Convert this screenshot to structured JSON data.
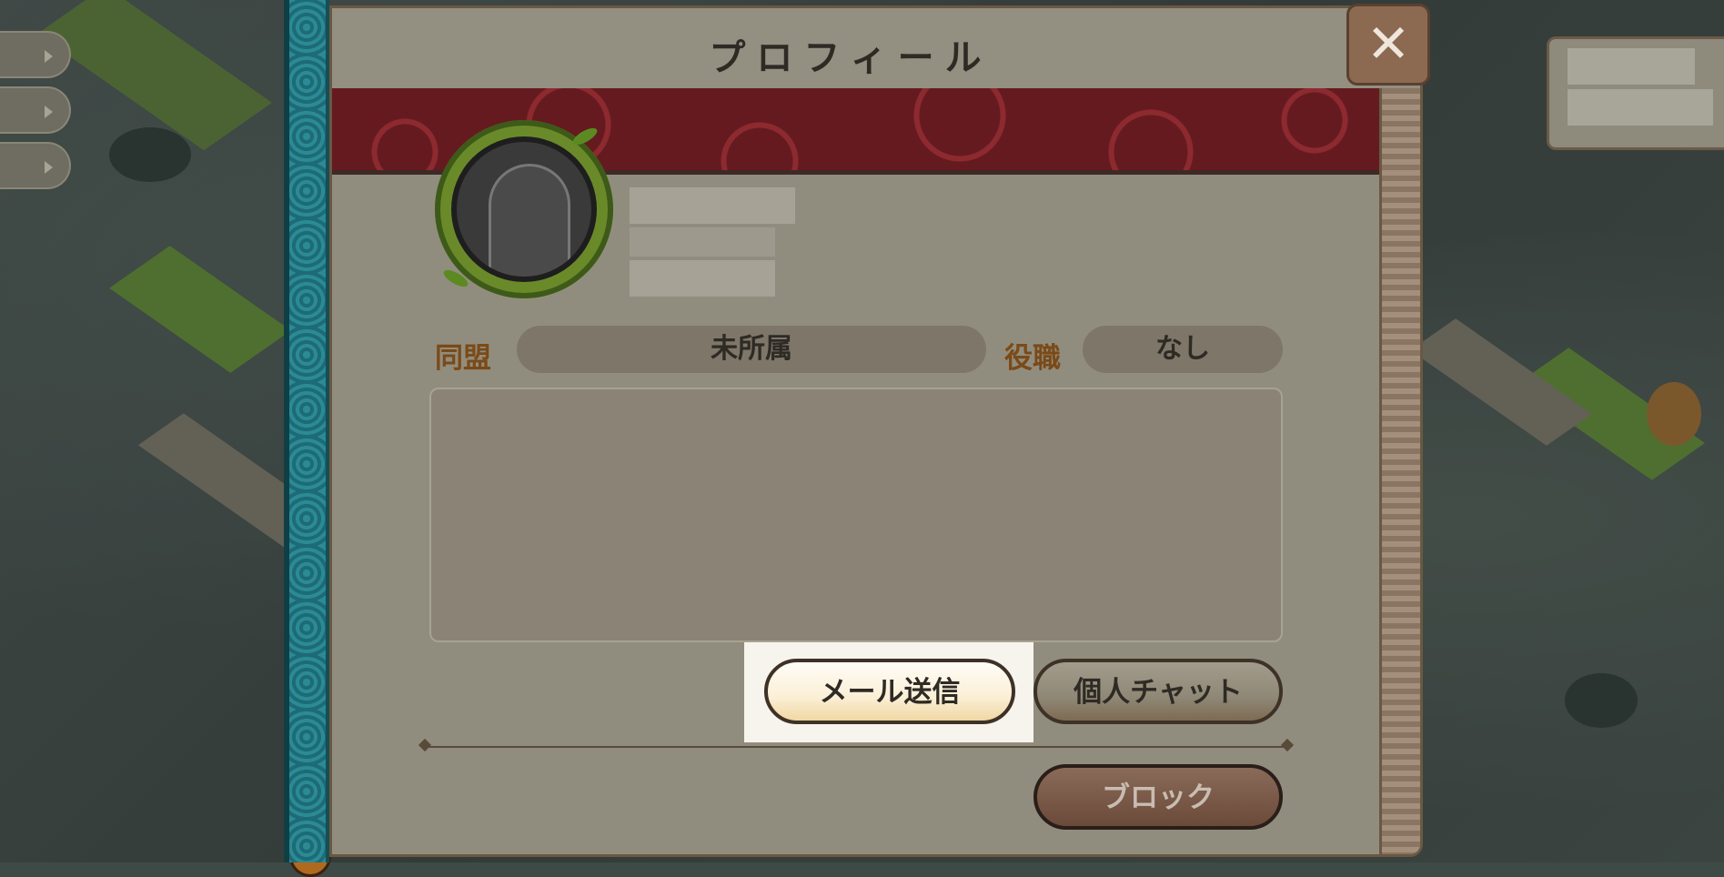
{
  "dialog": {
    "title": "プロフィール",
    "close_label": "✕"
  },
  "profile": {
    "alliance_label": "同盟",
    "alliance_value": "未所属",
    "role_label": "役職",
    "role_value": "なし",
    "bio": ""
  },
  "actions": {
    "mail_label": "メール送信",
    "chat_label": "個人チャット",
    "block_label": "ブロック"
  },
  "colors": {
    "banner": "#651a1f",
    "frame_teal": "#1f727d",
    "label_brown": "#7a4a18",
    "highlight": "#f6f4ec"
  }
}
